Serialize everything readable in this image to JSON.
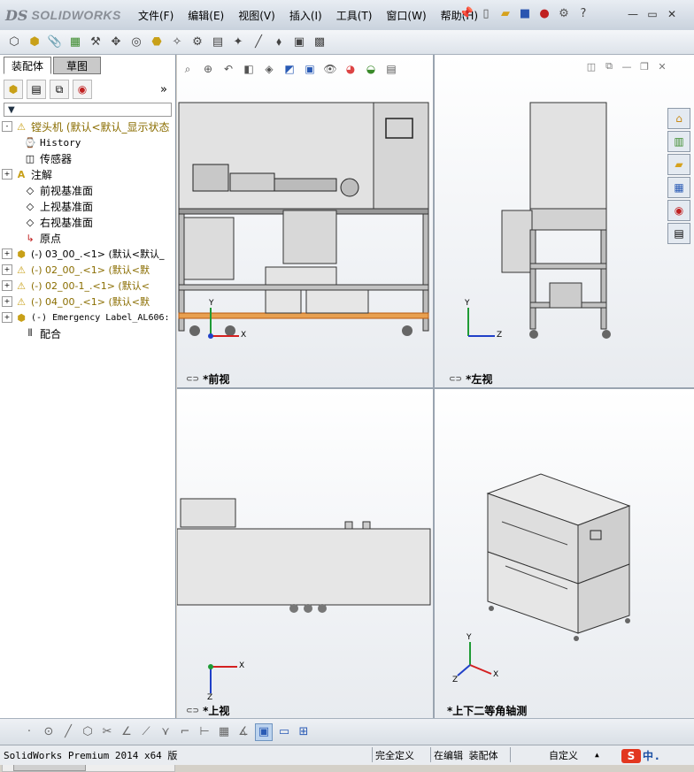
{
  "app": {
    "logo_ds": "DS",
    "logo_name": "SOLIDWORKS"
  },
  "menu": {
    "items": [
      "文件(F)",
      "编辑(E)",
      "视图(V)",
      "插入(I)",
      "工具(T)",
      "窗口(W)",
      "帮助(H)"
    ]
  },
  "window_controls": {
    "minimize": "—",
    "restore": "▭",
    "close": "✕"
  },
  "panel": {
    "tabs": [
      "装配体",
      "草图"
    ],
    "tree": [
      {
        "label": "镗头机 (默认<默认_显示状态",
        "icon": "assembly-warning-icon",
        "warn": true,
        "level": 0,
        "expander": "-"
      },
      {
        "label": "History",
        "icon": "history-icon",
        "level": 1,
        "expander": ""
      },
      {
        "label": "传感器",
        "icon": "sensor-icon",
        "level": 1,
        "expander": ""
      },
      {
        "label": "注解",
        "icon": "annotation-icon",
        "level": 1,
        "expander": "+"
      },
      {
        "label": "前视基准面",
        "icon": "plane-icon",
        "level": 1,
        "expander": ""
      },
      {
        "label": "上视基准面",
        "icon": "plane-icon",
        "level": 1,
        "expander": ""
      },
      {
        "label": "右视基准面",
        "icon": "plane-icon",
        "level": 1,
        "expander": ""
      },
      {
        "label": "原点",
        "icon": "origin-icon",
        "level": 1,
        "expander": ""
      },
      {
        "label": "(-) 03_00_.<1> (默认<默认_",
        "icon": "part-icon",
        "level": 1,
        "expander": "+"
      },
      {
        "label": "(-) 02_00_.<1> (默认<默",
        "icon": "part-warning-icon",
        "warn": true,
        "level": 1,
        "expander": "+"
      },
      {
        "label": "(-) 02_00-1_.<1> (默认<",
        "icon": "part-warning-icon",
        "warn": true,
        "level": 1,
        "expander": "+"
      },
      {
        "label": "(-) 04_00_.<1> (默认<默",
        "icon": "part-warning-icon",
        "warn": true,
        "level": 1,
        "expander": "+"
      },
      {
        "label": "(-) Emergency Label_AL606:",
        "icon": "part-icon",
        "level": 1,
        "expander": "+"
      },
      {
        "label": "配合",
        "icon": "mates-icon",
        "level": 1,
        "expander": ""
      }
    ]
  },
  "viewports": {
    "front": {
      "label": "*前视",
      "x_axis": "X",
      "y_axis": "Y"
    },
    "left": {
      "label": "*左视",
      "z_axis": "Z",
      "y_axis": "Y"
    },
    "top": {
      "label": "*上视",
      "x_axis": "X",
      "z_axis": "Z"
    },
    "iso": {
      "label": "*上下二等角轴测",
      "x_axis": "X",
      "y_axis": "Y",
      "z_axis": "Z"
    }
  },
  "status": {
    "product": "SolidWorks Premium 2014 x64 版",
    "definition": "完全定义",
    "mode": "在编辑 装配体",
    "units": "自定义",
    "arrow": "▲"
  },
  "ime": {
    "logo": "S",
    "lang": "中",
    "punct": "."
  },
  "colors": {
    "x_axis": "#d42020",
    "y_axis": "#1f9b35",
    "z_axis": "#2040c8"
  }
}
